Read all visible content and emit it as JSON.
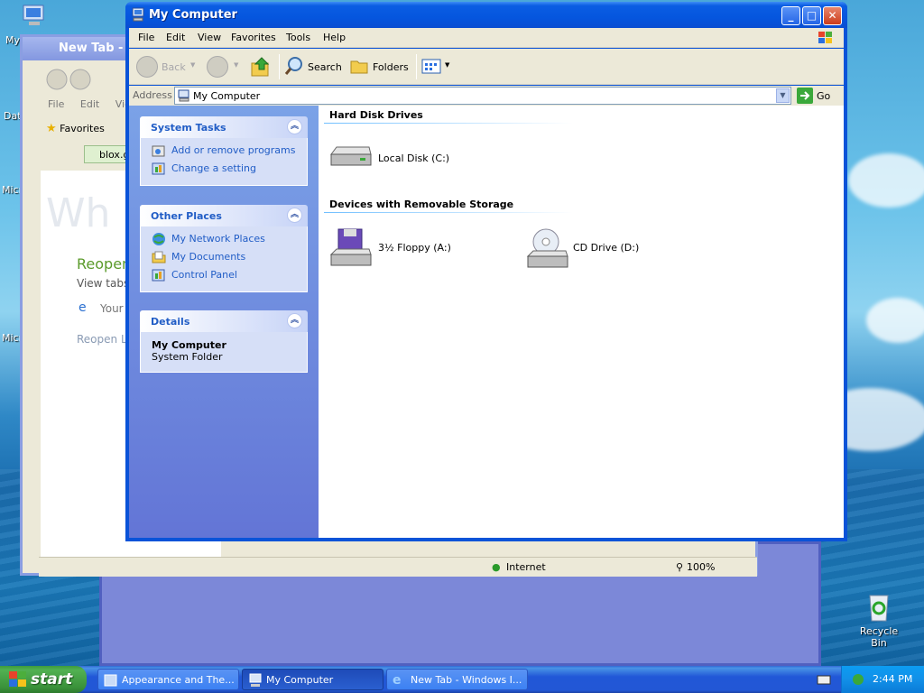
{
  "desktop": {
    "icons": [
      {
        "label": "My D",
        "key": "my-documents"
      },
      {
        "label": "Dat",
        "key": "data"
      },
      {
        "label": "Micr",
        "key": "microsoft-1"
      },
      {
        "label": "Micr",
        "key": "microsoft-2"
      }
    ],
    "recycle_bin": "Recycle Bin"
  },
  "ie_window": {
    "title": "New Tab - W",
    "menu": [
      "File",
      "Edit",
      "View"
    ],
    "favorites": "Favorites",
    "tab": "blox.g",
    "content": {
      "big_text": "Wh",
      "reopen_heading": "Reopen",
      "view_tabs": "View tabs",
      "your": "Your",
      "reopen_last": "Reopen L"
    },
    "status": {
      "zone": "Internet",
      "zoom": "100%"
    }
  },
  "window": {
    "title": "My Computer",
    "menu": [
      "File",
      "Edit",
      "View",
      "Favorites",
      "Tools",
      "Help"
    ],
    "toolbar": {
      "back": "Back",
      "search": "Search",
      "folders": "Folders"
    },
    "address": {
      "label": "Address",
      "value": "My Computer",
      "go": "Go"
    }
  },
  "tasks": {
    "system_tasks": {
      "title": "System Tasks",
      "links": [
        "Add or remove programs",
        "Change a setting"
      ]
    },
    "other_places": {
      "title": "Other Places",
      "links": [
        "My Network Places",
        "My Documents",
        "Control Panel"
      ]
    },
    "details": {
      "title": "Details",
      "name": "My Computer",
      "type": "System Folder"
    }
  },
  "sections": {
    "hard_disk": {
      "title": "Hard Disk Drives",
      "items": [
        "Local Disk (C:)"
      ]
    },
    "removable": {
      "title": "Devices with Removable Storage",
      "items": [
        "3½ Floppy (A:)",
        "CD Drive (D:)"
      ]
    }
  },
  "taskbar": {
    "start": "start",
    "buttons": [
      "Appearance and The...",
      "My Computer",
      "New Tab - Windows I..."
    ],
    "active_index": 1,
    "clock": "2:44 PM"
  }
}
